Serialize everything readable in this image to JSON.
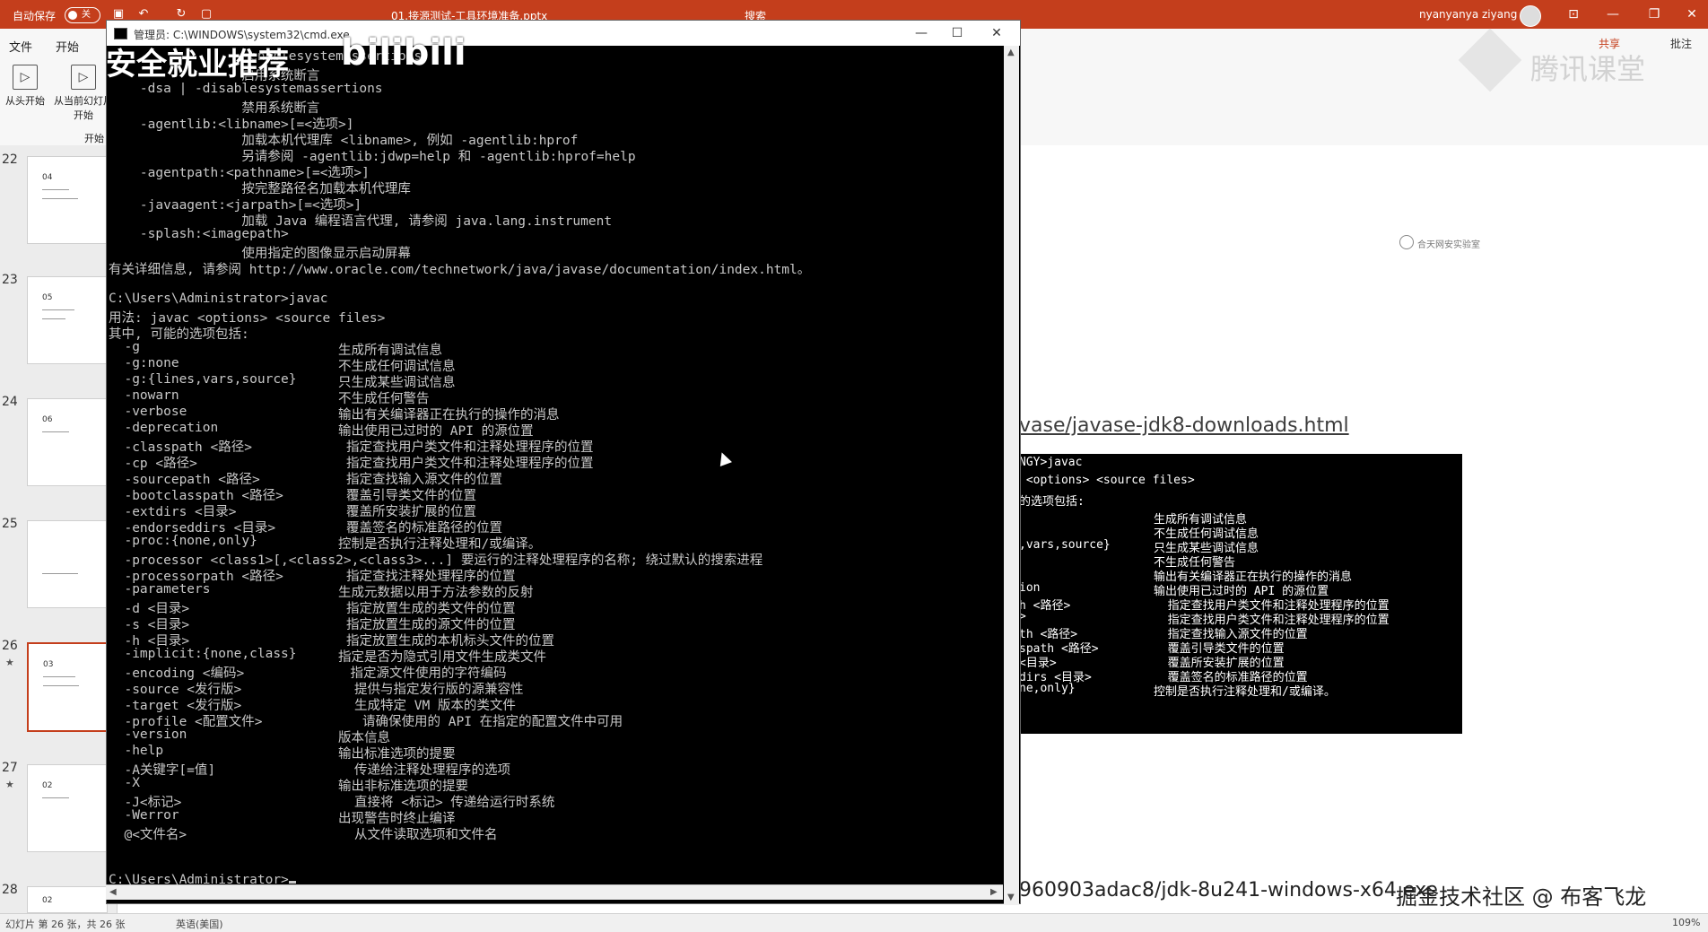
{
  "ppt": {
    "autosave_label": "自动保存",
    "autosave_state": "关",
    "file_title": "01.接源测试-工具环境准备.pptx",
    "search_hint": "搜索",
    "user_name": "nyanyanya ziyang",
    "share_label": "共享",
    "comment_label": "批注",
    "menu": [
      "文件",
      "开始"
    ],
    "ribbon_buttons": [
      "从头开始",
      "从当前幻灯片开始"
    ],
    "ribbon_group": "开始",
    "slide_numbers": [
      "22",
      "23",
      "24",
      "25",
      "26",
      "27",
      "28"
    ],
    "thumb_labels": [
      "04",
      "05",
      "06",
      "",
      "03",
      "02",
      "02"
    ],
    "selected_slide": "26",
    "status_left": "幻灯片 第 26 张，共 26 张",
    "status_lang": "英语(美国)",
    "status_zoom": "109%"
  },
  "slide": {
    "link_text": "vase/javase-jdk8-downloads.html",
    "url_text": "960903adac8/jdk-8u241-windows-x64.exe",
    "logo_text": "合天网安实验室",
    "term_title": "NGY>javac",
    "term_usage": " <options> <source files>",
    "term_options_header": "的选项包括:",
    "term_rows": [
      {
        "a": "",
        "b": "生成所有调试信息"
      },
      {
        "a": "",
        "b": "不生成任何调试信息"
      },
      {
        "a": ",vars,source}",
        "b": "只生成某些调试信息"
      },
      {
        "a": "",
        "b": "不生成任何警告"
      },
      {
        "a": "",
        "b": "输出有关编译器正在执行的操作的消息"
      },
      {
        "a": "ion",
        "b": "输出使用已过时的 API 的源位置"
      },
      {
        "a": "h <路径>",
        "b": "  指定查找用户类文件和注释处理程序的位置"
      },
      {
        "a": ">",
        "b": "  指定查找用户类文件和注释处理程序的位置"
      },
      {
        "a": "th <路径>",
        "b": "  指定查找输入源文件的位置"
      },
      {
        "a": "spath <路径>",
        "b": "  覆盖引导类文件的位置"
      },
      {
        "a": "<目录>",
        "b": "  覆盖所安装扩展的位置"
      },
      {
        "a": "dirs <目录>",
        "b": "  覆盖签名的标准路径的位置"
      },
      {
        "a": "ne,only}",
        "b": "控制是否执行注释处理和/或编译。"
      }
    ]
  },
  "watermarks": {
    "bili_text": "安全就业推荐",
    "bili_logo": "bilibili",
    "tencent": "腾讯课堂",
    "juejin": "掘金技术社区 @ 布客飞龙"
  },
  "cmd": {
    "title": "管理员: C:\\WINDOWS\\system32\\cmd.exe",
    "top_lines": [
      "                 -enablesystemassertions",
      "                 启用系统断言",
      "    -dsa | -disablesystemassertions",
      "                 禁用系统断言",
      "    -agentlib:<libname>[=<选项>]",
      "                 加载本机代理库 <libname>, 例如 -agentlib:hprof",
      "                 另请参阅 -agentlib:jdwp=help 和 -agentlib:hprof=help",
      "    -agentpath:<pathname>[=<选项>]",
      "                 按完整路径名加载本机代理库",
      "    -javaagent:<jarpath>[=<选项>]",
      "                 加载 Java 编程语言代理, 请参阅 java.lang.instrument",
      "    -splash:<imagepath>",
      "                 使用指定的图像显示启动屏幕",
      "有关详细信息, 请参阅 http://www.oracle.com/technetwork/java/javase/documentation/index.html。",
      "",
      "C:\\Users\\Administrator>javac",
      "用法: javac <options> <source files>",
      "其中, 可能的选项包括:"
    ],
    "options": [
      {
        "o": "  -g",
        "d": "生成所有调试信息",
        "i": 0
      },
      {
        "o": "  -g:none",
        "d": "不生成任何调试信息",
        "i": 0
      },
      {
        "o": "  -g:{lines,vars,source}",
        "d": "只生成某些调试信息",
        "i": 0
      },
      {
        "o": "  -nowarn",
        "d": "不生成任何警告",
        "i": 0
      },
      {
        "o": "  -verbose",
        "d": "输出有关编译器正在执行的操作的消息",
        "i": 0
      },
      {
        "o": "  -deprecation",
        "d": "输出使用已过时的 API 的源位置",
        "i": 0
      },
      {
        "o": "  -classpath <路径>",
        "d": "指定查找用户类文件和注释处理程序的位置",
        "i": 1
      },
      {
        "o": "  -cp <路径>",
        "d": "指定查找用户类文件和注释处理程序的位置",
        "i": 1
      },
      {
        "o": "  -sourcepath <路径>",
        "d": "指定查找输入源文件的位置",
        "i": 1
      },
      {
        "o": "  -bootclasspath <路径>",
        "d": "覆盖引导类文件的位置",
        "i": 1
      },
      {
        "o": "  -extdirs <目录>",
        "d": "覆盖所安装扩展的位置",
        "i": 1
      },
      {
        "o": "  -endorseddirs <目录>",
        "d": "覆盖签名的标准路径的位置",
        "i": 1
      },
      {
        "o": "  -proc:{none,only}",
        "d": "控制是否执行注释处理和/或编译。",
        "i": 0
      },
      {
        "o": "  -processor <class1>[,<class2>,<class3>...] 要运行的注释处理程序的名称; 绕过默认的搜索进程",
        "d": "",
        "i": 0
      },
      {
        "o": "  -processorpath <路径>",
        "d": "指定查找注释处理程序的位置",
        "i": 1
      },
      {
        "o": "  -parameters",
        "d": "生成元数据以用于方法参数的反射",
        "i": 0
      },
      {
        "o": "  -d <目录>",
        "d": "指定放置生成的类文件的位置",
        "i": 1
      },
      {
        "o": "  -s <目录>",
        "d": "指定放置生成的源文件的位置",
        "i": 1
      },
      {
        "o": "  -h <目录>",
        "d": "指定放置生成的本机标头文件的位置",
        "i": 1
      },
      {
        "o": "  -implicit:{none,class}",
        "d": "指定是否为隐式引用文件生成类文件",
        "i": 0
      },
      {
        "o": "  -encoding <编码>",
        "d": "指定源文件使用的字符编码",
        "i": 1.5
      },
      {
        "o": "  -source <发行版>",
        "d": "提供与指定发行版的源兼容性",
        "i": 2
      },
      {
        "o": "  -target <发行版>",
        "d": "生成特定 VM 版本的类文件",
        "i": 2
      },
      {
        "o": "  -profile <配置文件>",
        "d": "请确保使用的 API 在指定的配置文件中可用",
        "i": 3
      },
      {
        "o": "  -version",
        "d": "版本信息",
        "i": 0
      },
      {
        "o": "  -help",
        "d": "输出标准选项的提要",
        "i": 0
      },
      {
        "o": "  -A关键字[=值]",
        "d": "传递给注释处理程序的选项",
        "i": 2
      },
      {
        "o": "  -X",
        "d": "输出非标准选项的提要",
        "i": 0
      },
      {
        "o": "  -J<标记>",
        "d": "直接将 <标记> 传递给运行时系统",
        "i": 2
      },
      {
        "o": "  -Werror",
        "d": "出现警告时终止编译",
        "i": 0
      },
      {
        "o": "  @<文件名>",
        "d": "从文件读取选项和文件名",
        "i": 2
      }
    ],
    "prompt": "C:\\Users\\Administrator>"
  },
  "colors": {
    "ppt_accent": "#c43e1c",
    "console_bg": "#000000",
    "console_fg": "#c8c8c8"
  }
}
